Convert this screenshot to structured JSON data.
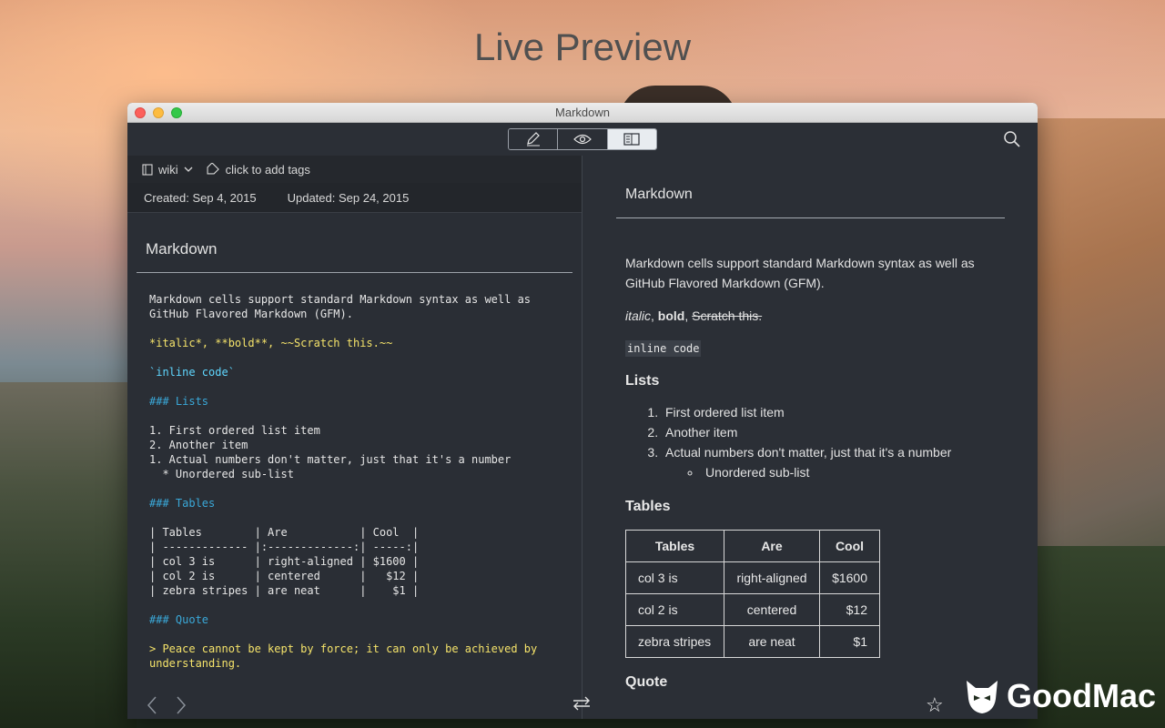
{
  "headline": "Live Preview",
  "window": {
    "title": "Markdown"
  },
  "toolbar": {
    "modes": [
      "edit-pencil",
      "preview-eye",
      "split-view"
    ],
    "active_mode": "split-view"
  },
  "editor": {
    "notebook": "wiki",
    "tags_placeholder": "click to add tags",
    "created": "Created: Sep 4, 2015",
    "updated": "Updated: Sep 24, 2015",
    "title": "Markdown",
    "lines": {
      "l1": "Markdown cells support standard Markdown syntax as well as",
      "l2": "GitHub Flavored Markdown (GFM).",
      "l3": "*italic*, **bold**, ~~Scratch this.~~",
      "l4": "`inline code`",
      "l5": "### Lists",
      "l6": "1. First ordered list item",
      "l7": "2. Another item",
      "l8": "1. Actual numbers don't matter, just that it's a number",
      "l9": "  * Unordered sub-list",
      "l10": "### Tables",
      "l11": "| Tables        | Are           | Cool  |",
      "l12": "| ------------- |:-------------:| -----:|",
      "l13": "| col 3 is      | right-aligned | $1600 |",
      "l14": "| col 2 is      | centered      |   $12 |",
      "l15": "| zebra stripes | are neat      |    $1 |",
      "l16": "### Quote",
      "l17": "> Peace cannot be kept by force; it can only be achieved by",
      "l18": "understanding."
    }
  },
  "preview": {
    "title": "Markdown",
    "intro": "Markdown cells support standard Markdown syntax as well as GitHub Flavored Markdown (GFM).",
    "italic": "italic",
    "bold": "bold",
    "strike": "Scratch this.",
    "inline_code": "inline code",
    "lists_heading": "Lists",
    "list_items": [
      "First ordered list item",
      "Another item",
      "Actual numbers don't matter, just that it's a number"
    ],
    "sub_item": "Unordered sub-list",
    "tables_heading": "Tables",
    "table": {
      "headers": [
        "Tables",
        "Are",
        "Cool"
      ],
      "rows": [
        [
          "col 3 is",
          "right-aligned",
          "$1600"
        ],
        [
          "col 2 is",
          "centered",
          "$12"
        ],
        [
          "zebra stripes",
          "are neat",
          "$1"
        ]
      ]
    },
    "quote_heading": "Quote"
  },
  "watermark": "GoodMac"
}
